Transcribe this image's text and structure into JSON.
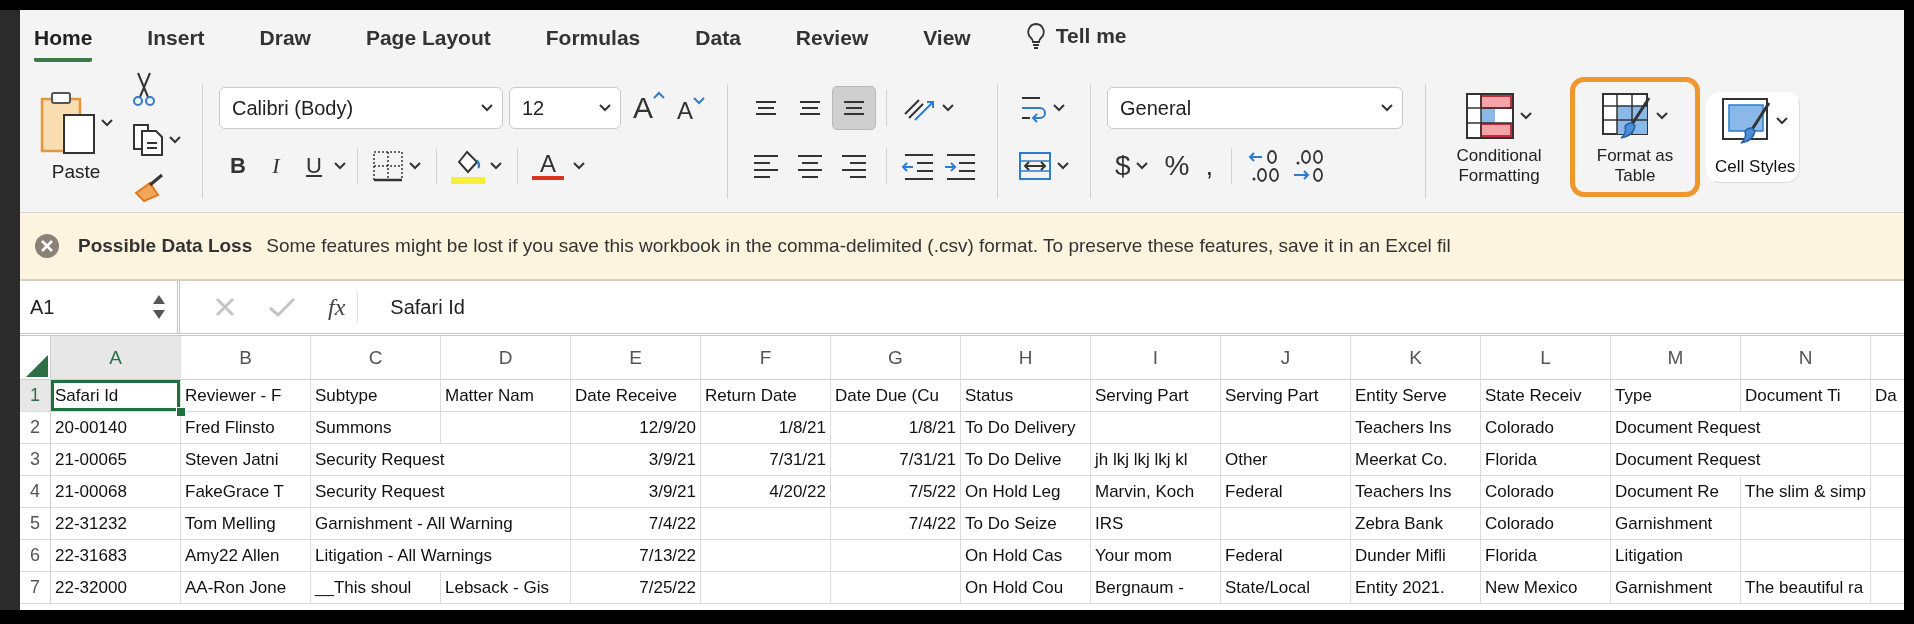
{
  "tabs": [
    {
      "label": "Home",
      "selected": true
    },
    {
      "label": "Insert",
      "selected": false
    },
    {
      "label": "Draw",
      "selected": false
    },
    {
      "label": "Page Layout",
      "selected": false
    },
    {
      "label": "Formulas",
      "selected": false
    },
    {
      "label": "Data",
      "selected": false
    },
    {
      "label": "Review",
      "selected": false
    },
    {
      "label": "View",
      "selected": false
    }
  ],
  "tell_me": {
    "label": "Tell me"
  },
  "ribbon": {
    "paste": {
      "label": "Paste"
    },
    "font_name": {
      "value": "Calibri (Body)"
    },
    "font_size": {
      "value": "12"
    },
    "font_size_buttons": [
      {
        "kind": "grow",
        "label": "A"
      },
      {
        "kind": "shrink",
        "label": "A"
      }
    ],
    "style_buttons": [
      {
        "kind": "bold",
        "label": "B"
      },
      {
        "kind": "italic",
        "label": "I"
      },
      {
        "kind": "underline",
        "label": "U"
      }
    ],
    "font_color": {
      "label": "A"
    },
    "alignment_buttons": [
      {
        "kind": "top",
        "selected": false
      },
      {
        "kind": "middle",
        "selected": false
      },
      {
        "kind": "bottom",
        "selected": true
      },
      {
        "kind": "left",
        "selected": false
      },
      {
        "kind": "center",
        "selected": false
      },
      {
        "kind": "right",
        "selected": false
      }
    ],
    "number_format": {
      "value": "General"
    },
    "number_buttons": [
      {
        "kind": "currency",
        "label": "$"
      },
      {
        "kind": "percent",
        "label": "%"
      },
      {
        "kind": "comma",
        "label": ","
      }
    ],
    "styles": [
      {
        "kind": "conditional",
        "label": "Conditional Formatting",
        "highlighted": false
      },
      {
        "kind": "table",
        "label": "Format as Table",
        "highlighted": true
      },
      {
        "kind": "cell",
        "label": "Cell Styles",
        "highlighted": false
      }
    ]
  },
  "notification": {
    "title": "Possible Data Loss",
    "message": "Some features might be lost if you save this workbook in the comma-delimited (.csv) format. To preserve these features, save it in an Excel fil"
  },
  "formula_bar": {
    "name_box": "A1",
    "fx": "fx",
    "formula": "Safari Id"
  },
  "sheet": {
    "columns": [
      {
        "label": "A",
        "selected": true
      },
      {
        "label": "B",
        "selected": false
      },
      {
        "label": "C",
        "selected": false
      },
      {
        "label": "D",
        "selected": false
      },
      {
        "label": "E",
        "selected": false
      },
      {
        "label": "F",
        "selected": false
      },
      {
        "label": "G",
        "selected": false
      },
      {
        "label": "H",
        "selected": false
      },
      {
        "label": "I",
        "selected": false
      },
      {
        "label": "J",
        "selected": false
      },
      {
        "label": "K",
        "selected": false
      },
      {
        "label": "L",
        "selected": false
      },
      {
        "label": "M",
        "selected": false
      },
      {
        "label": "N",
        "selected": false
      }
    ],
    "rows": [
      {
        "number": "1",
        "selected": true,
        "cells": [
          {
            "text": "Safari Id",
            "kind": "text"
          },
          {
            "text": "Reviewer - F",
            "kind": "text"
          },
          {
            "text": "Subtype",
            "kind": "text"
          },
          {
            "text": "Matter Nam",
            "kind": "text"
          },
          {
            "text": "Date Receive",
            "kind": "text"
          },
          {
            "text": "Return Date",
            "kind": "text"
          },
          {
            "text": "Date Due (Cu",
            "kind": "text"
          },
          {
            "text": "Status",
            "kind": "text"
          },
          {
            "text": "Serving Part",
            "kind": "text"
          },
          {
            "text": "Serving Part",
            "kind": "text"
          },
          {
            "text": "Entity Serve",
            "kind": "text"
          },
          {
            "text": "State Receiv",
            "kind": "text"
          },
          {
            "text": "Type",
            "kind": "text"
          },
          {
            "text": "Document Ti",
            "kind": "text"
          },
          {
            "text": "Da",
            "kind": "text"
          }
        ]
      },
      {
        "number": "2",
        "selected": false,
        "cells": [
          {
            "text": "20-00140",
            "kind": "text"
          },
          {
            "text": "Fred Flinsto",
            "kind": "text"
          },
          {
            "text": "Summons",
            "kind": "text"
          },
          null,
          {
            "text": "12/9/20",
            "kind": "date"
          },
          {
            "text": "1/8/21",
            "kind": "date"
          },
          {
            "text": "1/8/21",
            "kind": "date"
          },
          {
            "text": "To Do Delivery",
            "kind": "text"
          },
          null,
          null,
          {
            "text": "Teachers Ins",
            "kind": "text"
          },
          {
            "text": "Colorado",
            "kind": "text"
          },
          {
            "text": "Document Request",
            "kind": "text"
          },
          null,
          null
        ]
      },
      {
        "number": "3",
        "selected": false,
        "cells": [
          {
            "text": "21-00065",
            "kind": "text"
          },
          {
            "text": "Steven Jatni",
            "kind": "text"
          },
          {
            "text": "Security Request",
            "kind": "text"
          },
          null,
          {
            "text": "3/9/21",
            "kind": "date"
          },
          {
            "text": "7/31/21",
            "kind": "date"
          },
          {
            "text": "7/31/21",
            "kind": "date"
          },
          {
            "text": "To Do Delive",
            "kind": "text"
          },
          {
            "text": "jh lkj lkj lkj kl",
            "kind": "text"
          },
          {
            "text": "Other",
            "kind": "text"
          },
          {
            "text": "Meerkat Co.",
            "kind": "text"
          },
          {
            "text": "Florida",
            "kind": "text"
          },
          {
            "text": "Document Request",
            "kind": "text"
          },
          null,
          null
        ]
      },
      {
        "number": "4",
        "selected": false,
        "cells": [
          {
            "text": "21-00068",
            "kind": "text"
          },
          {
            "text": "FakeGrace T",
            "kind": "text"
          },
          {
            "text": "Security Request",
            "kind": "text"
          },
          null,
          {
            "text": "3/9/21",
            "kind": "date"
          },
          {
            "text": "4/20/22",
            "kind": "date"
          },
          {
            "text": "7/5/22",
            "kind": "date"
          },
          {
            "text": "On Hold Leg",
            "kind": "text"
          },
          {
            "text": "Marvin, Koch",
            "kind": "text"
          },
          {
            "text": "Federal",
            "kind": "text"
          },
          {
            "text": "Teachers Ins",
            "kind": "text"
          },
          {
            "text": "Colorado",
            "kind": "text"
          },
          {
            "text": "Document Re",
            "kind": "text"
          },
          {
            "text": "The slim & simp",
            "kind": "text"
          },
          null
        ]
      },
      {
        "number": "5",
        "selected": false,
        "cells": [
          {
            "text": "22-31232",
            "kind": "text"
          },
          {
            "text": "Tom Melling",
            "kind": "text"
          },
          {
            "text": "Garnishment - All Warning",
            "kind": "text"
          },
          null,
          {
            "text": "7/4/22",
            "kind": "date"
          },
          null,
          {
            "text": "7/4/22",
            "kind": "date"
          },
          {
            "text": "To Do Seize",
            "kind": "text"
          },
          {
            "text": "IRS",
            "kind": "text"
          },
          null,
          {
            "text": "Zebra Bank",
            "kind": "text"
          },
          {
            "text": "Colorado",
            "kind": "text"
          },
          {
            "text": "Garnishment",
            "kind": "text"
          },
          null,
          null
        ]
      },
      {
        "number": "6",
        "selected": false,
        "cells": [
          {
            "text": "22-31683",
            "kind": "text"
          },
          {
            "text": "Amy22 Allen",
            "kind": "text"
          },
          {
            "text": "Litigation - All Warnings",
            "kind": "text"
          },
          null,
          {
            "text": "7/13/22",
            "kind": "date"
          },
          null,
          null,
          {
            "text": "On Hold Cas",
            "kind": "text"
          },
          {
            "text": "Your mom",
            "kind": "text"
          },
          {
            "text": "Federal",
            "kind": "text"
          },
          {
            "text": "Dunder Mifli",
            "kind": "text"
          },
          {
            "text": "Florida",
            "kind": "text"
          },
          {
            "text": "Litigation",
            "kind": "text"
          },
          null,
          null
        ]
      },
      {
        "number": "7",
        "selected": false,
        "cells": [
          {
            "text": "22-32000",
            "kind": "text"
          },
          {
            "text": "AA-Ron Jone",
            "kind": "text"
          },
          {
            "text": "__This shoul",
            "kind": "text"
          },
          {
            "text": "Lebsack - Gis",
            "kind": "text"
          },
          {
            "text": "7/25/22",
            "kind": "date"
          },
          null,
          null,
          {
            "text": "On Hold Cou",
            "kind": "text"
          },
          {
            "text": "Bergnaum -",
            "kind": "text"
          },
          {
            "text": "State/Local",
            "kind": "text"
          },
          {
            "text": "Entity 2021.",
            "kind": "text"
          },
          {
            "text": "New Mexico",
            "kind": "text"
          },
          {
            "text": "Garnishment",
            "kind": "text"
          },
          {
            "text": "The beautiful ra",
            "kind": "text"
          },
          null
        ]
      }
    ]
  }
}
